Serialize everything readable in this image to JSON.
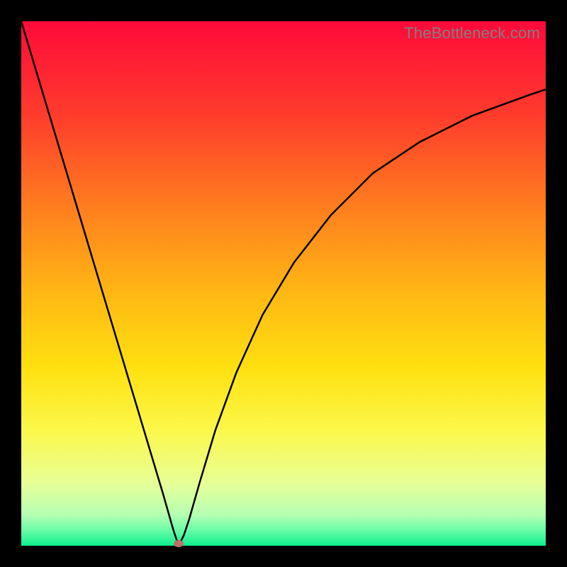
{
  "watermark": "TheBottleneck.com",
  "colors": {
    "background": "#000000",
    "curve": "#000000",
    "marker": "#bb7268",
    "watermark_text": "#7f7f7f"
  },
  "chart_data": {
    "type": "line",
    "title": "",
    "xlabel": "",
    "ylabel": "",
    "xlim": [
      0,
      100
    ],
    "ylim": [
      0,
      100
    ],
    "gradient_stops": [
      {
        "pos": 0,
        "color": "#ff0a3a"
      },
      {
        "pos": 18,
        "color": "#ff3c2c"
      },
      {
        "pos": 35,
        "color": "#ff7c1f"
      },
      {
        "pos": 52,
        "color": "#ffb813"
      },
      {
        "pos": 66,
        "color": "#ffe010"
      },
      {
        "pos": 78,
        "color": "#fbf84a"
      },
      {
        "pos": 88,
        "color": "#e8ff97"
      },
      {
        "pos": 94,
        "color": "#b7ffb2"
      },
      {
        "pos": 97,
        "color": "#6cfca8"
      },
      {
        "pos": 100,
        "color": "#0af08c"
      }
    ],
    "series": [
      {
        "name": "bottleneck-curve",
        "x": [
          0,
          3,
          6,
          9,
          12,
          15,
          18,
          21,
          24,
          27,
          29,
          30,
          31,
          32,
          34,
          37,
          41,
          46,
          52,
          59,
          67,
          76,
          86,
          97,
          100
        ],
        "y": [
          100,
          90,
          80,
          70,
          60,
          50,
          40,
          30,
          20,
          10,
          3,
          0,
          2,
          5,
          12,
          22,
          33,
          44,
          54,
          63,
          71,
          77,
          82,
          86,
          87
        ]
      }
    ],
    "annotations": [
      {
        "name": "optimal-point",
        "x": 30,
        "y": 0
      }
    ]
  }
}
